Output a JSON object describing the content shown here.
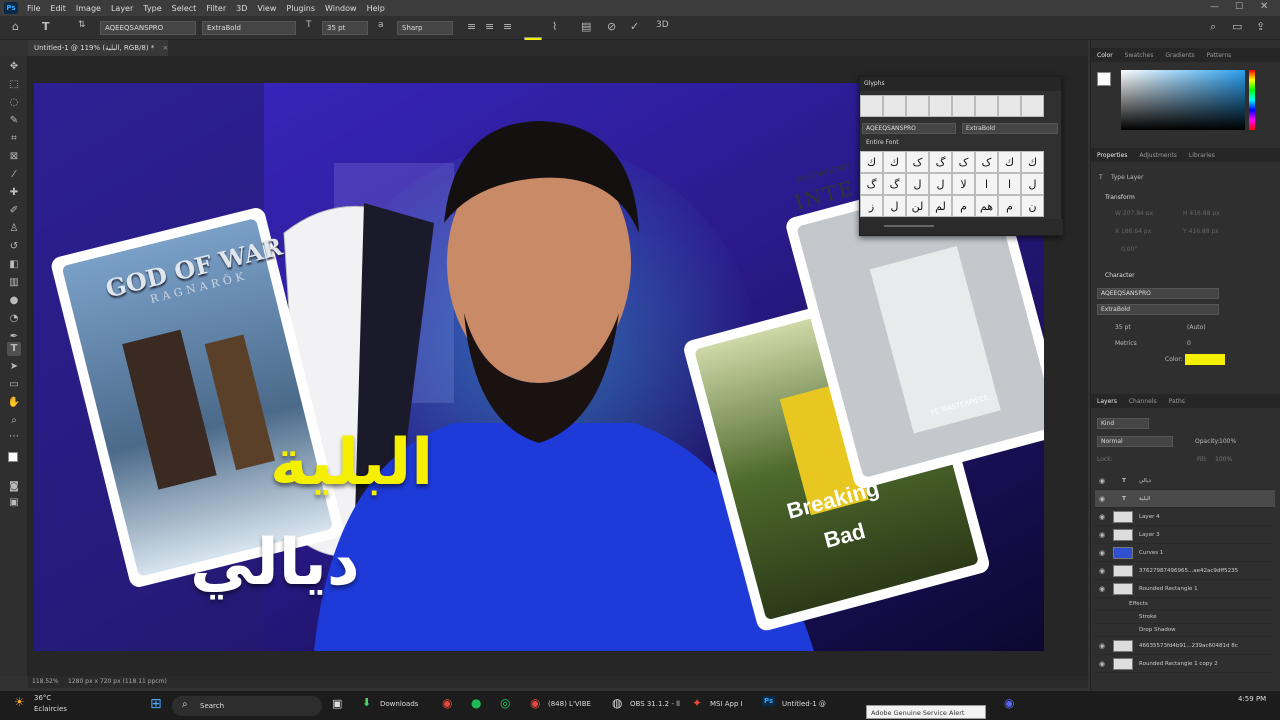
{
  "app": {
    "logo": "Ps",
    "menu": [
      "File",
      "Edit",
      "Image",
      "Layer",
      "Type",
      "Select",
      "Filter",
      "3D",
      "View",
      "Plugins",
      "Window",
      "Help"
    ]
  },
  "options": {
    "font_family": "AQEEQSANSPRO",
    "font_style": "ExtraBold",
    "font_size": "35 pt",
    "antialias": "Sharp",
    "text_color": "#f4f000"
  },
  "document": {
    "tab_title": "Untitled-1 @ 119% (البلية, RGB/8) *",
    "zoom": "118.52%",
    "info": "1280 px x 720 px (118.11 ppcm)"
  },
  "canvas": {
    "poster1_title": "GOD OF WAR",
    "poster1_subtitle": "RAGNARÖK",
    "poster2_title_line1": "Breaking",
    "poster2_title_line2": "Bad",
    "poster3_text": "INTE",
    "poster3_header": "McCONAUGHEY",
    "poster3_footer": "FE MASTERPIECE.",
    "yellow_text": "البلية",
    "white_text": "ديالي"
  },
  "glyphs": {
    "title": "Glyphs",
    "font": "AQEEQSANSPRO",
    "style": "ExtraBold",
    "set": "Entire Font",
    "rows": [
      [
        "ك",
        "ك",
        "ک",
        "گ",
        "ک",
        "ک",
        "ك",
        "ك"
      ],
      [
        "گ",
        "گ",
        "ل",
        "ل",
        "لا",
        "ا",
        "ا",
        "ل"
      ],
      [
        "ز",
        "ل",
        "لن",
        "لم",
        "م",
        "هم",
        "م",
        "ن"
      ]
    ]
  },
  "color_panel": {
    "tabs": [
      "Color",
      "Swatches",
      "Gradients",
      "Patterns"
    ]
  },
  "properties": {
    "tabs": [
      "Properties",
      "Adjustments",
      "Libraries"
    ],
    "layer_type": "Type Layer",
    "transform_label": "Transform",
    "w": "W  207.84 px",
    "h": "H  416.88 px",
    "x": "X  186.64 px",
    "y": "Y  416.88 px",
    "angle": "0.00°",
    "character_label": "Character",
    "font": "AQEEQSANSPRO",
    "style": "ExtraBold",
    "size": "35 pt",
    "leading": "(Auto)",
    "kerning": "Metrics",
    "tracking": "0",
    "color_label": "Color:",
    "color": "#f4f000"
  },
  "layers": {
    "tabs": [
      "Layers",
      "Channels",
      "Paths"
    ],
    "kind": "Kind",
    "blend": "Normal",
    "opacity_label": "Opacity:",
    "opacity": "100%",
    "lock_label": "Lock:",
    "fill_label": "Fill:",
    "fill": "100%",
    "items": [
      "ديالي",
      "البلية",
      "Layer 4",
      "Layer 3",
      "Curves 1",
      "37627987496965...ae42ac9dff5235",
      "Rounded Rectangle 1",
      "Effects",
      "Stroke",
      "Drop Shadow",
      "46635573fd4b91...239ac60481d 8c",
      "Rounded Rectangle 1 copy 2"
    ]
  },
  "taskbar": {
    "weather_temp": "36°C",
    "weather_desc": "Eclaircies",
    "search": "Search",
    "items": [
      "Downloads",
      "(848) L'VIBE",
      "OBS 31.1.2 - ll",
      "MSI App I",
      "Untitled-1 @"
    ],
    "tooltip": "Adobe Genuine Service Alert",
    "time": "4:59 PM"
  }
}
